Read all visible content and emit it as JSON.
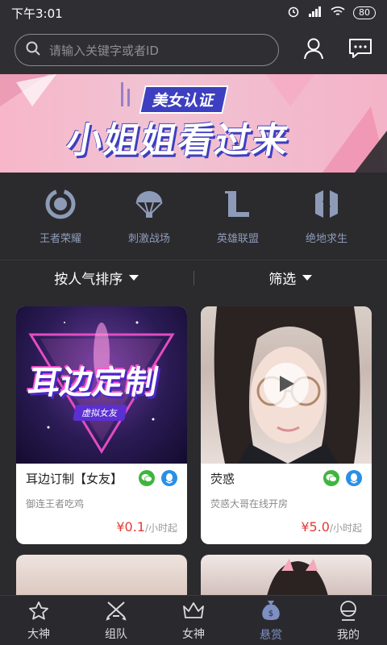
{
  "status_bar": {
    "time": "下午3:01",
    "battery": "80"
  },
  "search": {
    "placeholder": "请输入关键字或者ID"
  },
  "banner": {
    "tag": "美女认证",
    "headline": "小姐姐看过来"
  },
  "categories": [
    {
      "label": "王者荣耀",
      "icon": "honor-of-kings-icon"
    },
    {
      "label": "刺激战场",
      "icon": "parachute-icon"
    },
    {
      "label": "英雄联盟",
      "icon": "league-of-legends-icon"
    },
    {
      "label": "绝地求生",
      "icon": "pubg-icon"
    }
  ],
  "sort": {
    "popularity": "按人气排序",
    "filter": "筛选"
  },
  "cards": [
    {
      "image_title": "耳边定制",
      "image_subtitle": "虚拟女友",
      "name": "耳边订制【女友】",
      "desc": "御连王者吃鸡",
      "price": "¥0.1",
      "unit": "/小时起"
    },
    {
      "name": "荧惑",
      "desc": "荧惑大哥在线开房",
      "price": "¥5.0",
      "unit": "/小时起"
    }
  ],
  "tabs": [
    {
      "label": "大神"
    },
    {
      "label": "组队"
    },
    {
      "label": "女神"
    },
    {
      "label": "悬赏"
    },
    {
      "label": "我的"
    }
  ],
  "colors": {
    "accent": "#7e8fc3",
    "price": "#e53935",
    "wechat": "#3fb53f",
    "qq": "#2a8fe6"
  }
}
